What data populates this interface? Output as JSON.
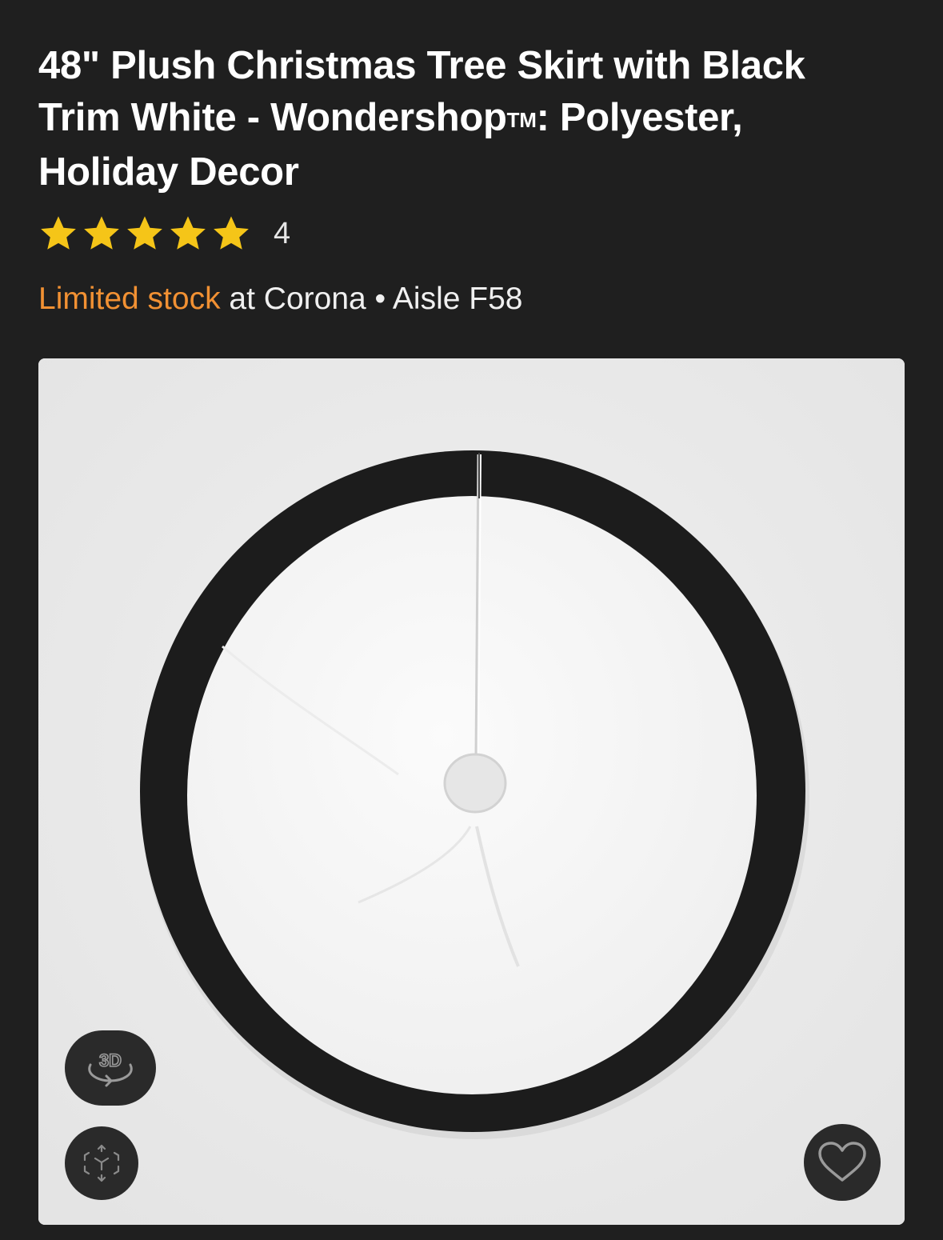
{
  "product": {
    "title_line1": "48\" Plush Christmas Tree Skirt with Black",
    "title_line2_start": "Trim White - Wondershop",
    "title_trademark": "TM",
    "title_line2_end": ": Polyester,",
    "title_line3": "Holiday Decor",
    "rating": {
      "stars": 5,
      "review_count": "4"
    },
    "stock": {
      "status": "Limited stock",
      "location": " at Corona",
      "separator": " • ",
      "aisle": "Aisle F58"
    }
  },
  "gallery": {
    "three_d_label": "3D",
    "buttons": {
      "three_d": "3d-view-icon",
      "ar": "ar-cube-icon",
      "favorite": "heart-icon"
    }
  },
  "colors": {
    "background": "#1f1f1f",
    "stock_accent": "#f29133",
    "star": "#f5c518",
    "image_bg": "#e9e9e9",
    "skirt_trim": "#1c1c1c",
    "skirt_body": "#f7f7f7"
  }
}
